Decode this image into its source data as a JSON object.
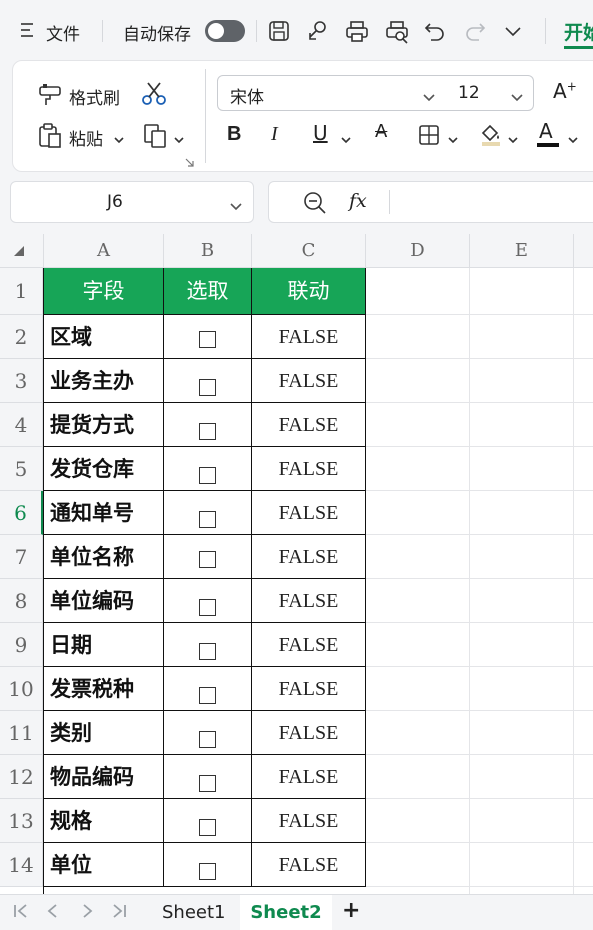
{
  "menubar": {
    "file_label": "文件",
    "autosave_label": "自动保存",
    "autosave_on": false,
    "start_tab_label": "开始"
  },
  "ribbon": {
    "format_painter_label": "格式刷",
    "paste_label": "粘贴",
    "font_name": "宋体",
    "font_size": "12",
    "grow_font_glyph": "A",
    "bold_glyph": "B",
    "italic_glyph": "I",
    "underline_glyph": "U",
    "strike_glyph": "A",
    "font_color_glyph": "A",
    "font_color": "#111111"
  },
  "formula_bar": {
    "cell_ref": "J6",
    "fx_label": "fx",
    "formula_value": ""
  },
  "sheet": {
    "columns": [
      "A",
      "B",
      "C",
      "D",
      "E"
    ],
    "header": [
      "字段",
      "选取",
      "联动"
    ],
    "header_color": "#17a557",
    "selected_row": 6,
    "rows": [
      {
        "num": "1"
      },
      {
        "num": "2",
        "field": "区域",
        "link": "FALSE"
      },
      {
        "num": "3",
        "field": "业务主办",
        "link": "FALSE"
      },
      {
        "num": "4",
        "field": "提货方式",
        "link": "FALSE"
      },
      {
        "num": "5",
        "field": "发货仓库",
        "link": "FALSE"
      },
      {
        "num": "6",
        "field": "通知单号",
        "link": "FALSE"
      },
      {
        "num": "7",
        "field": "单位名称",
        "link": "FALSE"
      },
      {
        "num": "8",
        "field": "单位编码",
        "link": "FALSE"
      },
      {
        "num": "9",
        "field": "日期",
        "link": "FALSE"
      },
      {
        "num": "10",
        "field": "发票税种",
        "link": "FALSE"
      },
      {
        "num": "11",
        "field": "类别",
        "link": "FALSE"
      },
      {
        "num": "12",
        "field": "物品编码",
        "link": "FALSE"
      },
      {
        "num": "13",
        "field": "规格",
        "link": "FALSE"
      },
      {
        "num": "14",
        "field": "单位",
        "link": "FALSE"
      }
    ]
  },
  "sheet_tabs": {
    "tabs": [
      "Sheet1",
      "Sheet2"
    ],
    "active": "Sheet2",
    "add_glyph": "+"
  },
  "accent_color": "#0f8a4f"
}
